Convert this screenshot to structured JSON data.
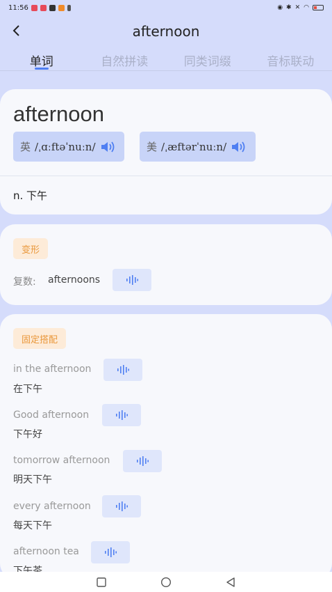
{
  "status": {
    "time": "11:56",
    "app_icons": [
      "#e74a5a",
      "#e74a5a",
      "#333333",
      "#f08b2a",
      "#555555"
    ]
  },
  "header": {
    "title": "afternoon",
    "back_icon": "chevron-left-icon"
  },
  "tabs": [
    {
      "label": "单词",
      "active": true
    },
    {
      "label": "自然拼读",
      "active": false
    },
    {
      "label": "同类词缀",
      "active": false
    },
    {
      "label": "音标联动",
      "active": false
    }
  ],
  "word_card": {
    "word": "afternoon",
    "uk": {
      "label": "英",
      "ipa": "/ˌɑːftəˈnuːn/"
    },
    "us": {
      "label": "美",
      "ipa": "/ˌæftərˈnuːn/"
    },
    "meaning": "n. 下午"
  },
  "forms_card": {
    "tag": "变形",
    "plural_label": "复数:",
    "plural_word": "afternoons"
  },
  "collocations_card": {
    "tag": "固定搭配",
    "items": [
      {
        "en": "in the afternoon",
        "cn": "在下午"
      },
      {
        "en": "Good afternoon",
        "cn": "下午好"
      },
      {
        "en": "tomorrow afternoon",
        "cn": "明天下午"
      },
      {
        "en": "every afternoon",
        "cn": "每天下午"
      },
      {
        "en": "afternoon tea",
        "cn": "下午茶"
      }
    ]
  },
  "colors": {
    "accent": "#4f7ff2",
    "tag_bg": "#fdebd8",
    "tag_text": "#e9973a",
    "background": "#d5dcfb"
  },
  "navbar": {
    "icons": [
      "recent-apps-icon",
      "home-icon",
      "back-triangle-icon"
    ]
  }
}
